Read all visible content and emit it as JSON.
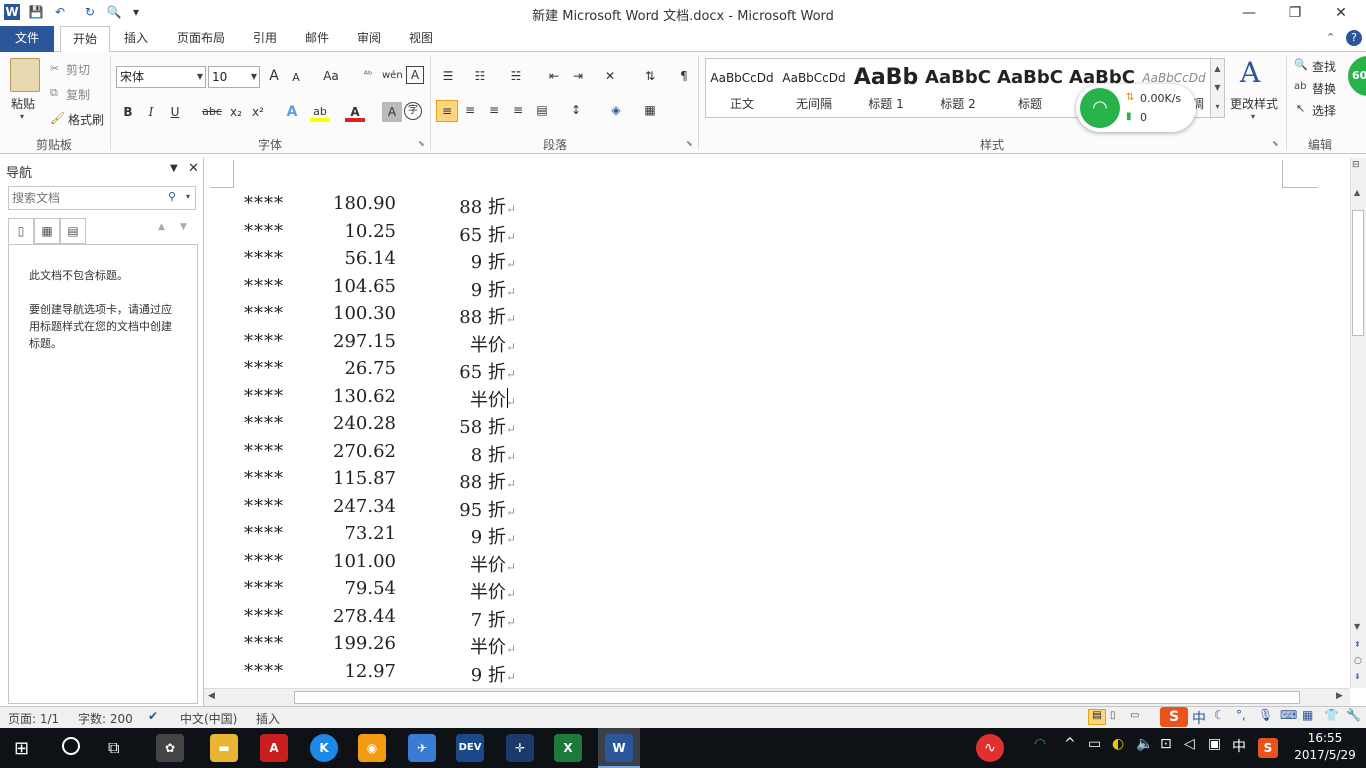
{
  "window": {
    "title": "新建 Microsoft Word 文档.docx - Microsoft Word",
    "minimize": "—",
    "restore": "❐",
    "close": "✕"
  },
  "quick_access": {
    "word_icon": "W",
    "save": "💾",
    "undo": "↶",
    "redo": "↻",
    "print_preview": "🔍"
  },
  "tabs": [
    "文件",
    "开始",
    "插入",
    "页面布局",
    "引用",
    "邮件",
    "审阅",
    "视图"
  ],
  "ribbon": {
    "clipboard": {
      "group": "剪贴板",
      "paste": "粘贴",
      "cut": "剪切",
      "copy": "复制",
      "format_painter": "格式刷"
    },
    "font": {
      "group": "字体",
      "font_name": "宋体",
      "font_size": "10",
      "bold": "B",
      "italic": "I",
      "underline": "U",
      "strike": "abc",
      "subscript": "x₂",
      "superscript": "x²",
      "grow": "A",
      "shrink": "A",
      "case": "Aa",
      "clear": "A",
      "font_color": "A",
      "char_border": "A"
    },
    "paragraph": {
      "group": "段落"
    },
    "styles": {
      "group": "样式",
      "items": [
        {
          "preview": "AaBbCcDd",
          "name": "正文"
        },
        {
          "preview": "AaBbCcDd",
          "name": "无间隔"
        },
        {
          "preview": "AaBb",
          "name": "标题 1"
        },
        {
          "preview": "AaBbC",
          "name": "标题 2"
        },
        {
          "preview": "AaBbC",
          "name": "标题"
        },
        {
          "preview": "AaBbC",
          "name": "副标题"
        },
        {
          "preview": "AaBbCcDd",
          "name": "不明显强调"
        }
      ],
      "change_styles": "更改样式"
    },
    "editing": {
      "group": "编辑",
      "find": "查找",
      "replace": "替换",
      "select": "选择"
    }
  },
  "net_widget": {
    "speed": "0.00K/s",
    "count": "0"
  },
  "nav_pane": {
    "title": "导航",
    "search_placeholder": "搜索文档",
    "msg1": "此文档不包含标题。",
    "msg2": "要创建导航选项卡，请通过应用标题样式在您的文档中创建标题。"
  },
  "document": {
    "rows": [
      {
        "name": "****",
        "price": "180.90",
        "discount": "88 折"
      },
      {
        "name": "****",
        "price": "10.25",
        "discount": "65 折"
      },
      {
        "name": "****",
        "price": "56.14",
        "discount": "9 折"
      },
      {
        "name": "****",
        "price": "104.65",
        "discount": "9 折"
      },
      {
        "name": "****",
        "price": "100.30",
        "discount": "88 折"
      },
      {
        "name": "****",
        "price": "297.15",
        "discount": "半价"
      },
      {
        "name": "****",
        "price": "26.75",
        "discount": "65 折"
      },
      {
        "name": "****",
        "price": "130.62",
        "discount": "半价"
      },
      {
        "name": "****",
        "price": "240.28",
        "discount": "58 折"
      },
      {
        "name": "****",
        "price": "270.62",
        "discount": "8 折"
      },
      {
        "name": "****",
        "price": "115.87",
        "discount": "88 折"
      },
      {
        "name": "****",
        "price": "247.34",
        "discount": "95 折"
      },
      {
        "name": "****",
        "price": "73.21",
        "discount": "9 折"
      },
      {
        "name": "****",
        "price": "101.00",
        "discount": "半价"
      },
      {
        "name": "****",
        "price": "79.54",
        "discount": "半价"
      },
      {
        "name": "****",
        "price": "278.44",
        "discount": "7 折"
      },
      {
        "name": "****",
        "price": "199.26",
        "discount": "半价"
      },
      {
        "name": "****",
        "price": "12.97",
        "discount": "9 折"
      }
    ],
    "paragraph_mark": "↵"
  },
  "status": {
    "page": "页面: 1/1",
    "words": "字数: 200",
    "lang": "中文(中国)",
    "mode": "插入"
  },
  "taskbar": {
    "time": "16:55",
    "date": "2017/5/29",
    "ime": "中",
    "ime2": "中",
    "badge": "60"
  },
  "colors": {
    "accent": "#2b579a",
    "taskbar": "#0e1116",
    "wifi_green": "#27b24a"
  }
}
